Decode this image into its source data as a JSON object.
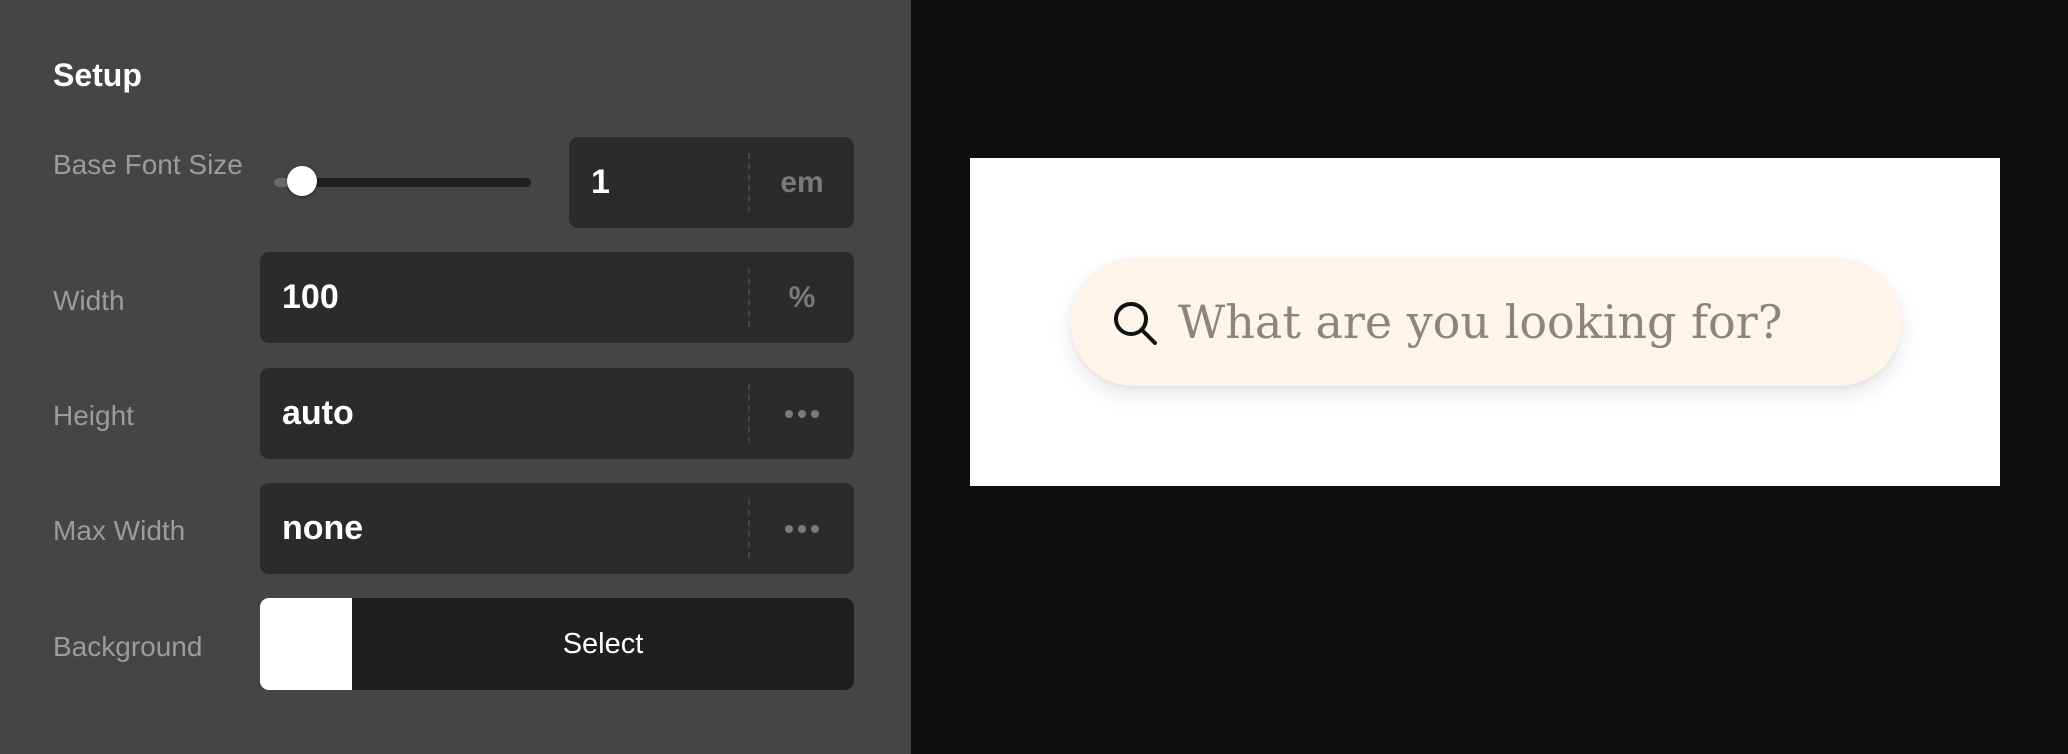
{
  "setup": {
    "title": "Setup",
    "base_font_size": {
      "label": "Base Font Size",
      "slider_fraction": 0.11,
      "value": "1",
      "unit": "em"
    },
    "width": {
      "label": "Width",
      "value": "100",
      "unit": "%"
    },
    "height": {
      "label": "Height",
      "value": "auto",
      "menu_icon": "more-dots-icon"
    },
    "max_width": {
      "label": "Max Width",
      "value": "none",
      "menu_icon": "more-dots-icon"
    },
    "background": {
      "label": "Background",
      "swatch_color": "#ffffff",
      "button_label": "Select"
    }
  },
  "preview": {
    "background": "#ffffff",
    "search": {
      "icon": "search-icon",
      "placeholder": "What are you looking for?",
      "pill_color": "#fdf5ea"
    }
  },
  "colors": {
    "panel_bg": "#454545",
    "field_bg": "#2b2b2b",
    "canvas_bg": "#0e0e0e"
  }
}
